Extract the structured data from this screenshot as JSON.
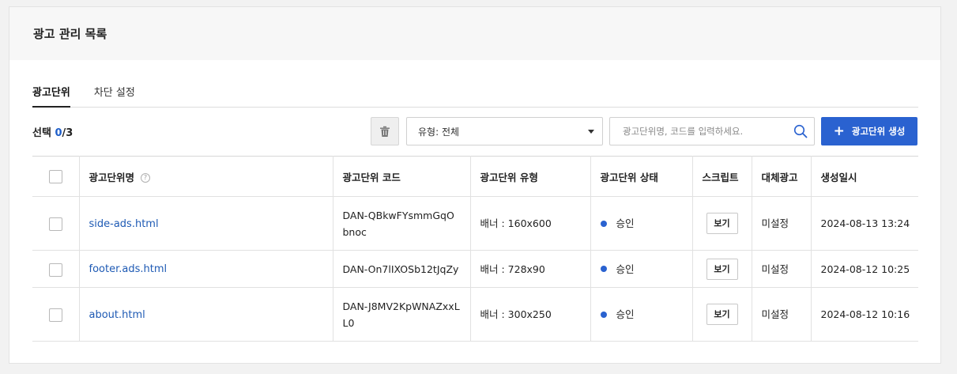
{
  "panel": {
    "title": "광고 관리 목록"
  },
  "tabs": [
    {
      "label": "광고단위",
      "active": true
    },
    {
      "label": "차단 설정",
      "active": false
    }
  ],
  "toolbar": {
    "select_prefix": "선택 ",
    "selected_count": "0",
    "total": "/3",
    "type_select_value": "유형: 전체",
    "search_placeholder": "광고단위명, 코드를 입력하세요.",
    "create_label": "광고단위 생성",
    "create_icon": "+"
  },
  "table": {
    "headers": {
      "name": "광고단위명",
      "help": "?",
      "code": "광고단위 코드",
      "type": "광고단위 유형",
      "status": "광고단위 상태",
      "script": "스크립트",
      "fallback": "대체광고",
      "created": "생성일시"
    },
    "rows": [
      {
        "name": "side-ads.html",
        "code": "DAN-QBkwFYsmmGqObnoc",
        "type": "배너 : 160x600",
        "status": "승인",
        "script": "보기",
        "fallback": "미설정",
        "created": "2024-08-13 13:24"
      },
      {
        "name": "footer.ads.html",
        "code": "DAN-On7lIXOSb12tJqZy",
        "type": "배너 : 728x90",
        "status": "승인",
        "script": "보기",
        "fallback": "미설정",
        "created": "2024-08-12 10:25"
      },
      {
        "name": "about.html",
        "code": "DAN-J8MV2KpWNAZxxLL0",
        "type": "배너 : 300x250",
        "status": "승인",
        "script": "보기",
        "fallback": "미설정",
        "created": "2024-08-12 10:16"
      }
    ]
  },
  "colors": {
    "accent": "#2a62d0",
    "link": "#1e5ab4",
    "status_approved": "#2a62d0"
  }
}
